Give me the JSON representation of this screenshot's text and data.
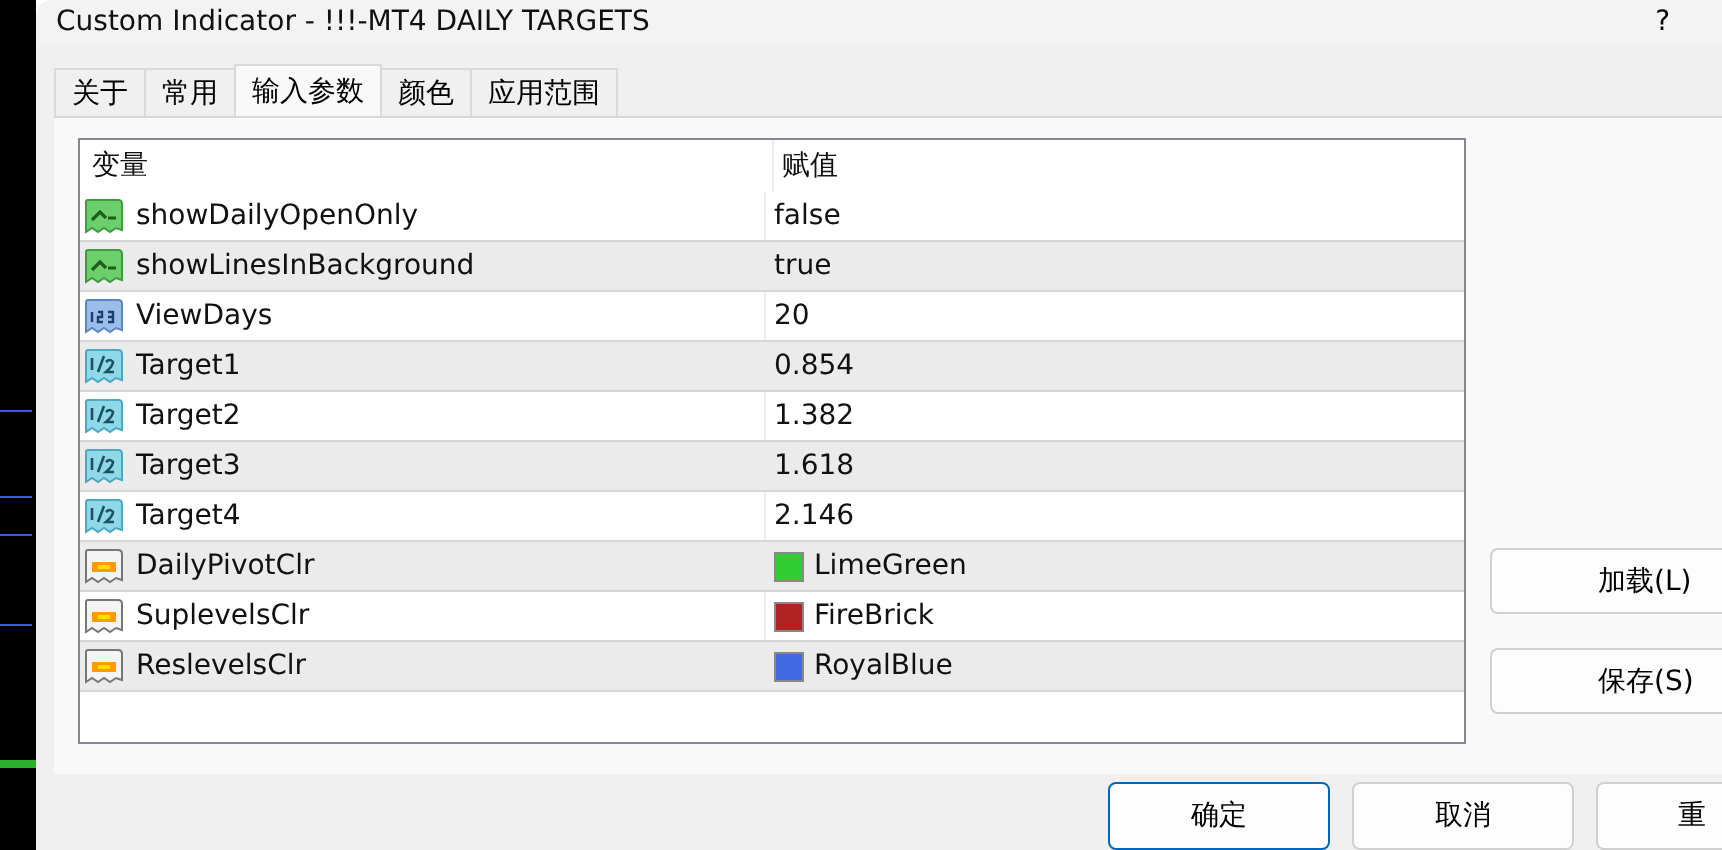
{
  "window": {
    "title": "Custom Indicator - !!!-MT4 DAILY TARGETS",
    "help": "?"
  },
  "tabs": [
    {
      "label": "关于",
      "selected": false
    },
    {
      "label": "常用",
      "selected": false
    },
    {
      "label": "输入参数",
      "selected": true
    },
    {
      "label": "颜色",
      "selected": false
    },
    {
      "label": "应用范围",
      "selected": false
    }
  ],
  "table": {
    "columns": [
      "变量",
      "赋值"
    ],
    "rows": [
      {
        "kind": "bool",
        "name": "showDailyOpenOnly",
        "value": "false"
      },
      {
        "kind": "bool",
        "name": "showLinesInBackground",
        "value": "true"
      },
      {
        "kind": "int",
        "name": "ViewDays",
        "value": "20"
      },
      {
        "kind": "double",
        "name": "Target1",
        "value": "0.854"
      },
      {
        "kind": "double",
        "name": "Target2",
        "value": "1.382"
      },
      {
        "kind": "double",
        "name": "Target3",
        "value": "1.618"
      },
      {
        "kind": "double",
        "name": "Target4",
        "value": "2.146"
      },
      {
        "kind": "color",
        "name": "DailyPivotClr",
        "value": "LimeGreen",
        "color": "#32cd32"
      },
      {
        "kind": "color",
        "name": "SuplevelsClr",
        "value": "FireBrick",
        "color": "#b22222"
      },
      {
        "kind": "color",
        "name": "ReslevelsClr",
        "value": "RoyalBlue",
        "color": "#4169e1"
      }
    ]
  },
  "side_buttons": [
    "加载(L)",
    "保存(S)"
  ],
  "bottom_buttons": [
    {
      "label": "确定",
      "selected": true
    },
    {
      "label": "取消",
      "selected": false
    },
    {
      "label": "重",
      "selected": false
    }
  ]
}
